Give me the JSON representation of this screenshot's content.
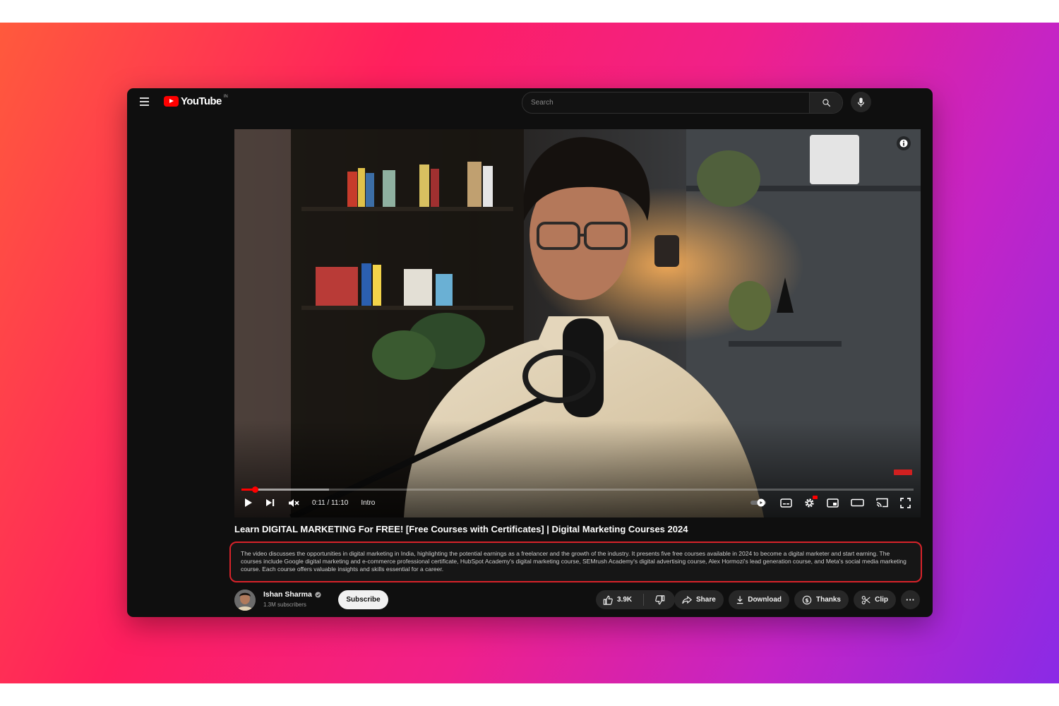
{
  "header": {
    "logo_text": "YouTube",
    "logo_superscript": "IN",
    "search_placeholder": "Search"
  },
  "player": {
    "time": "0:11 / 11:10",
    "chapter": "Intro",
    "played_fraction": 0.02,
    "buffered_fraction": 0.13
  },
  "video": {
    "title": "Learn DIGITAL MARKETING For FREE! [Free Courses with Certificates] | Digital Marketing Courses 2024",
    "description": "The video discusses the opportunities in digital marketing in India, highlighting the potential earnings as a freelancer and the growth of the industry. It presents five free courses available in 2024 to become a digital marketer and start earning. The courses include Google digital marketing and e-commerce professional certificate, HubSpot Academy's digital marketing course, SEMrush Academy's digital advertising course, Alex Hormozi's lead generation course, and Meta's social media marketing course. Each course offers valuable insights and skills essential for a career."
  },
  "channel": {
    "name": "Ishan Sharma",
    "subscribers": "1.3M subscribers",
    "subscribe_label": "Subscribe"
  },
  "actions": {
    "likes": "3.9K",
    "share": "Share",
    "download": "Download",
    "thanks": "Thanks",
    "clip": "Clip",
    "more": "···"
  },
  "colors": {
    "brand_red": "#ff0000",
    "highlight_border": "#d8232a",
    "background_gradient_start": "#ff5a3c",
    "background_gradient_end": "#8a2ae6"
  }
}
